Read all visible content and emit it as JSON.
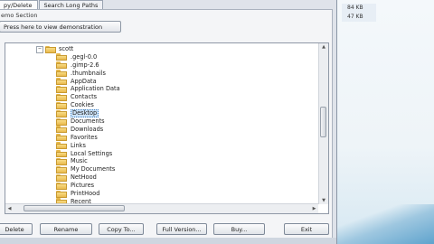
{
  "desktop": {
    "sizes": [
      "84 KB",
      "47 KB"
    ]
  },
  "tabs": [
    "py/Delete",
    "Search Long Paths"
  ],
  "section_label": "emo Section",
  "demo_button": "Press here to view demonstration",
  "tree": {
    "root": "scott",
    "items": [
      ".gegl-0.0",
      ".gimp-2.6",
      ".thumbnails",
      "AppData",
      "Application Data",
      "Contacts",
      "Cookies",
      "Desktop",
      "Documents",
      "Downloads",
      "Favorites",
      "Links",
      "Local Settings",
      "Music",
      "My Documents",
      "NetHood",
      "Pictures",
      "PrintHood",
      "Recent"
    ],
    "selected": "Desktop"
  },
  "buttons": [
    "Delete",
    "Rename",
    "Copy To...",
    "Full Version...",
    "Buy...",
    "Exit"
  ]
}
